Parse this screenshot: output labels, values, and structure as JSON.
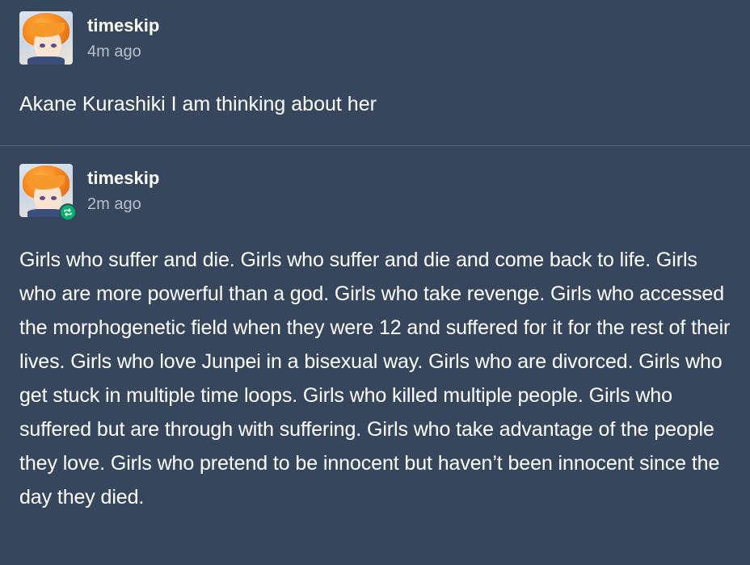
{
  "posts": [
    {
      "username": "timeskip",
      "timestamp": "4m ago",
      "is_reblog": false,
      "avatar_icon": "anime-avatar-icon",
      "body": "Akane Kurashiki I am thinking about her"
    },
    {
      "username": "timeskip",
      "timestamp": "2m ago",
      "is_reblog": true,
      "avatar_icon": "anime-avatar-icon",
      "badge_icon": "reblog-icon",
      "body": "Girls who suffer and die. Girls who suffer and die and come back to life. Girls who are more powerful than a god. Girls who take revenge. Girls who accessed the morphogenetic field when they were 12 and suffered for it for the rest of their lives. Girls who love Junpei in a bisexual way. Girls who are divorced. Girls who get stuck in multiple time loops. Girls who killed multiple people. Girls who suffered but are through with suffering. Girls who take advantage of the people they love. Girls who pretend to be innocent but haven’t been innocent since the day they died."
    }
  ],
  "colors": {
    "background": "#36465d",
    "text": "#ffffff",
    "muted_text": "rgba(255,255,255,0.65)",
    "reblog_badge": "#00b26b",
    "divider": "rgba(255,255,255,0.18)"
  }
}
